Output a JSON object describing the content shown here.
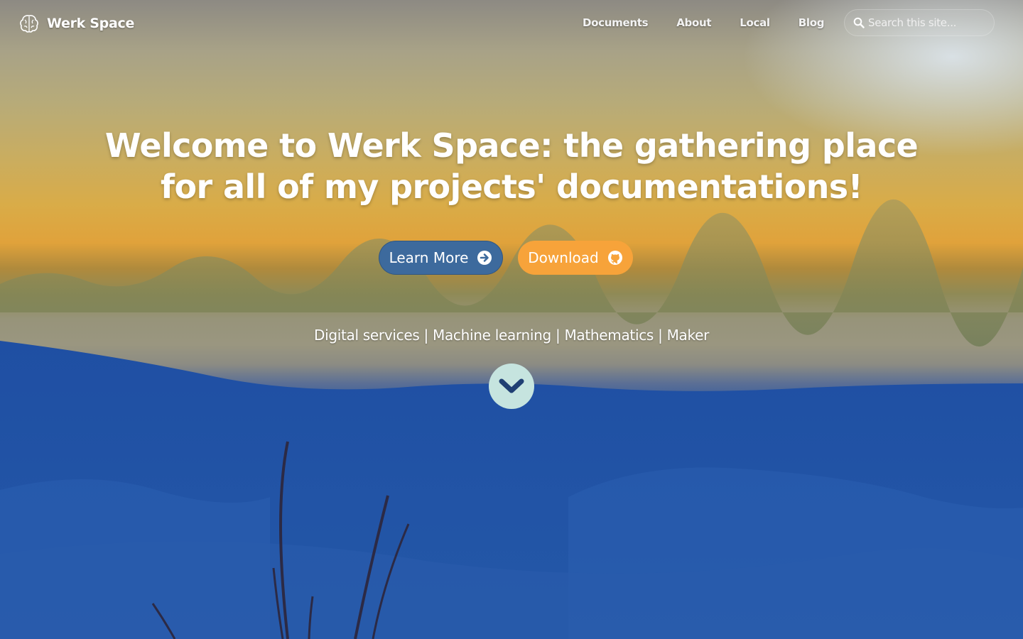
{
  "brand": {
    "name": "Werk Space",
    "logo_icon": "brain-icon"
  },
  "nav": {
    "items": [
      {
        "label": "Documents"
      },
      {
        "label": "About"
      },
      {
        "label": "Local"
      },
      {
        "label": "Blog"
      }
    ]
  },
  "search": {
    "placeholder": "Search this site...",
    "icon": "search-icon"
  },
  "hero": {
    "headline_line1": "Welcome to Werk Space: the gathering place",
    "headline_line2": "for all of my projects' documentations!",
    "learn_more_label": "Learn More",
    "learn_more_icon": "arrow-circle-right-icon",
    "download_label": "Download",
    "download_icon": "github-icon",
    "tagline": "Digital services | Machine learning | Mathematics | Maker",
    "scroll_icon": "chevron-down-icon"
  },
  "colors": {
    "learn_more_bg": "#3d6a9d",
    "download_bg": "#f7a33a",
    "scroll_button_bg": "#c6e4df",
    "scroll_chevron": "#1f3f73"
  }
}
